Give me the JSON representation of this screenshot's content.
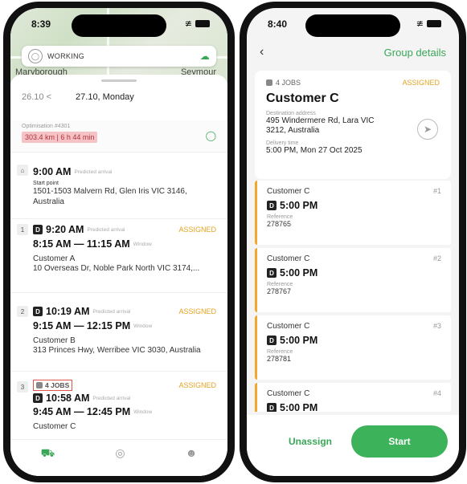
{
  "left": {
    "status_time": "8:39",
    "working_label": "WORKING",
    "map_labels": [
      "Maryborough",
      "Seymour"
    ],
    "date_prev": "26.10",
    "date_prev_arrow": "<",
    "date_current": "27.10, Monday",
    "optimisation_label": "Optimisation #4301",
    "optimisation_value": "303.4 km | 6 h 44 min",
    "start_stop": {
      "time": "9:00 AM",
      "time_note": "Predicted arrival",
      "label": "Start point",
      "address": "1501-1503 Malvern Rd, Glen Iris VIC 3146, Australia"
    },
    "stops": [
      {
        "index": "1",
        "time": "9:20 AM",
        "time_note": "Predicted arrival",
        "status": "ASSIGNED",
        "window": "8:15 AM — 11:15 AM",
        "window_note": "Window",
        "customer": "Customer A",
        "address": "10 Overseas Dr, Noble Park North VIC 3174,..."
      },
      {
        "index": "2",
        "time": "10:19 AM",
        "time_note": "Predicted arrival",
        "status": "ASSIGNED",
        "window": "9:15 AM — 12:15 PM",
        "window_note": "Window",
        "customer": "Customer B",
        "address": "313 Princes Hwy, Werribee VIC 3030, Australia"
      },
      {
        "index": "3",
        "jobs": "4 JOBS",
        "time": "10:58 AM",
        "time_note": "Predicted arrival",
        "status": "ASSIGNED",
        "window": "9:45 AM — 12:45 PM",
        "window_note": "Window",
        "customer": "Customer C"
      }
    ],
    "tabs": [
      "truck-icon",
      "location-pin-icon",
      "profile-icon"
    ]
  },
  "right": {
    "status_time": "8:40",
    "title": "Group details",
    "header": {
      "jobs": "4 JOBS",
      "status": "ASSIGNED",
      "customer": "Customer C",
      "address_label": "Destination address",
      "address": "495 Windermere Rd, Lara VIC 3212, Australia",
      "delivery_label": "Delivery time",
      "delivery": "5:00 PM, Mon 27 Oct 2025"
    },
    "jobs": [
      {
        "customer": "Customer C",
        "num": "#1",
        "time": "5:00 PM",
        "ref_label": "Reference",
        "ref": "278765"
      },
      {
        "customer": "Customer C",
        "num": "#2",
        "time": "5:00 PM",
        "ref_label": "Reference",
        "ref": "278767"
      },
      {
        "customer": "Customer C",
        "num": "#3",
        "time": "5:00 PM",
        "ref_label": "Reference",
        "ref": "278781"
      },
      {
        "customer": "Customer C",
        "num": "#4",
        "time": "5:00 PM",
        "ref_label": "",
        "ref": ""
      }
    ],
    "unassign": "Unassign",
    "start": "Start"
  },
  "colors": {
    "accent": "#3aa757",
    "assigned": "#e5a322",
    "job_border": "#f1a72e",
    "alert_bg": "#f5c3c6"
  }
}
